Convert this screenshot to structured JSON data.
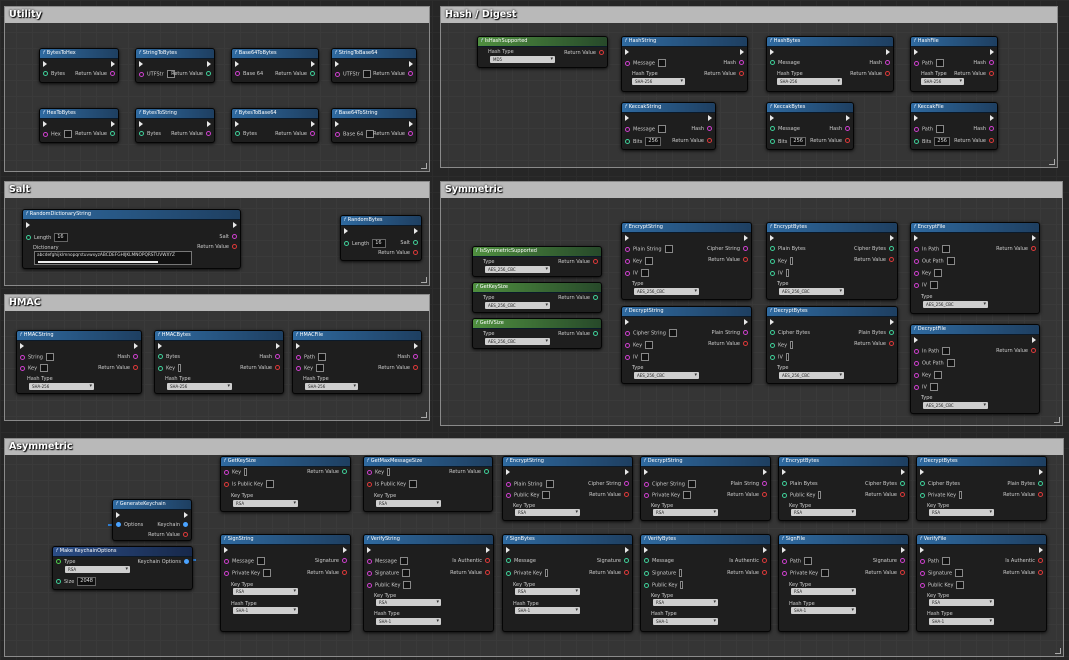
{
  "comments": {
    "utility": "Utility",
    "hash": "Hash / Digest",
    "salt": "Salt",
    "hmac": "HMAC",
    "symmetric": "Symmetric",
    "asymmetric": "Asymmetric"
  },
  "labels": {
    "return_value": "Return Value",
    "bytes": "Bytes",
    "utf_str": "UTFStr",
    "base64": "Base 64",
    "hex": "Hex",
    "hash_type": "Hash Type",
    "hash": "Hash",
    "message": "Message",
    "path": "Path",
    "bits": "Bits",
    "length": "Length",
    "salt": "Salt",
    "dictionary": "Dictionary",
    "string": "String",
    "key": "Key",
    "type": "Type",
    "plain_string": "Plain String",
    "cipher_string": "Cipher String",
    "iv": "IV",
    "plain_bytes": "Plain Bytes",
    "cipher_bytes": "Cipher Bytes",
    "in_path": "In Path",
    "out_path": "Out Path",
    "is_public_key": "Is Public Key",
    "key_type": "Key Type",
    "options": "Options",
    "keychain": "Keychain",
    "size": "Size",
    "keychain_options": "Keychain Options",
    "signature": "Signature",
    "private_key": "Private Key",
    "public_key": "Public Key",
    "is_authentic": "Is Authentic"
  },
  "values": {
    "sha256": "SHA-256",
    "sha1": "SHA-1",
    "md5": "MD5",
    "aes": "AES_256_CBC",
    "rsa": "RSA",
    "bits256": "256",
    "length16": "16",
    "size2048": "2048",
    "dictionary_text": "abcdefghijklmnopqrstuvwxyzABCDEFGHIJKLMNOPQRSTUVWXYZ"
  },
  "nodes": {
    "bytes_to_hex": "BytesToHex",
    "string_to_bytes": "StringToBytes",
    "base64_to_bytes": "Base64ToBytes",
    "string_to_base64": "StringToBase64",
    "hex_to_bytes": "HexToBytes",
    "bytes_to_string": "BytesToString",
    "bytes_to_base64": "BytesToBase64",
    "base64_to_string": "Base64ToString",
    "is_hash_supported": "IsHashSupported",
    "hash_string": "HashString",
    "hash_bytes": "HashBytes",
    "hash_file": "HashFile",
    "keccak_string": "KeccakString",
    "keccak_bytes": "KeccakBytes",
    "keccak_file": "KeccakFile",
    "random_dictionary_string": "RandomDictionaryString",
    "random_bytes": "RandomBytes",
    "hmac_string": "HMACString",
    "hmac_bytes": "HMACBytes",
    "hmac_file": "HMACFile",
    "is_symmetric_supported": "IsSymmetricSupported",
    "get_key_size": "GetKeySize",
    "get_iv_size": "GetIVSize",
    "encrypt_string": "EncryptString",
    "decrypt_string": "DecryptString",
    "encrypt_bytes": "EncryptBytes",
    "decrypt_bytes": "DecryptBytes",
    "encrypt_file": "EncryptFile",
    "decrypt_file": "DecryptFile",
    "get_max_message_size": "GetMaxMessageSize",
    "generate_keychain": "GenerateKeychain",
    "make_keychain_options": "Make KeychainOptions",
    "sign_string": "SignString",
    "verify_string": "VerifyString",
    "sign_bytes": "SignBytes",
    "verify_bytes": "VerifyBytes",
    "sign_file": "SignFile",
    "verify_file": "VerifyFile",
    "function_glyph": "f"
  },
  "colors": {
    "function_header": "#2f6aa0",
    "pure_header": "#4f8f3f",
    "exec_pin": "#e8e8e8",
    "string_pin": "#d040d0",
    "bytes_pin": "#3fd19a",
    "bool_pin": "#e03a3a",
    "struct_pin": "#4aa3ff"
  }
}
